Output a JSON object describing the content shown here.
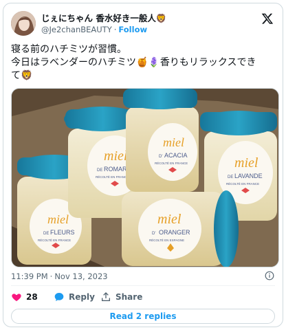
{
  "author": {
    "display_name": "じぇにちゃん 香水好き一般人🦁",
    "handle": "@Je2chanBEAUTY",
    "separator": "·",
    "follow_label": "Follow"
  },
  "tweet": {
    "lines": [
      "寝る前のハチミツが習慣。",
      "今日はラベンダーのハチミツ🍯🪻香りもリラックスでき",
      "て🦁"
    ]
  },
  "media": {
    "jar_labels": [
      {
        "brand": "miel",
        "flower_prefix": "DE",
        "flower": "ROMARIN",
        "origin": "RÉCOLTÉ EN FRANCE"
      },
      {
        "brand": "miel",
        "flower_prefix": "D'",
        "flower": "ACACIA",
        "origin": "RÉCOLTÉ EN FRANCE"
      },
      {
        "brand": "miel",
        "flower_prefix": "DE",
        "flower": "LAVANDE",
        "origin": "RÉCOLTÉ EN FRANCE"
      },
      {
        "brand": "miel",
        "flower_prefix": "DE",
        "flower": "FLEURS",
        "origin": "RÉCOLTÉ EN FRANCE"
      },
      {
        "brand": "miel",
        "flower_prefix": "D'",
        "flower": "ORANGER",
        "origin": "RÉCOLTÉ EN ESPAGNE"
      }
    ],
    "lid_color": "#1f8fb0",
    "label_accent": "#e6a028"
  },
  "meta": {
    "time": "11:39 PM",
    "separator": "·",
    "date": "Nov 13, 2023"
  },
  "actions": {
    "likes": "28",
    "reply_label": "Reply",
    "share_label": "Share"
  },
  "read_replies_label": "Read 2 replies",
  "colors": {
    "accent": "#1d9bf0",
    "like": "#f91880",
    "text": "#0f1419",
    "muted": "#536471"
  }
}
